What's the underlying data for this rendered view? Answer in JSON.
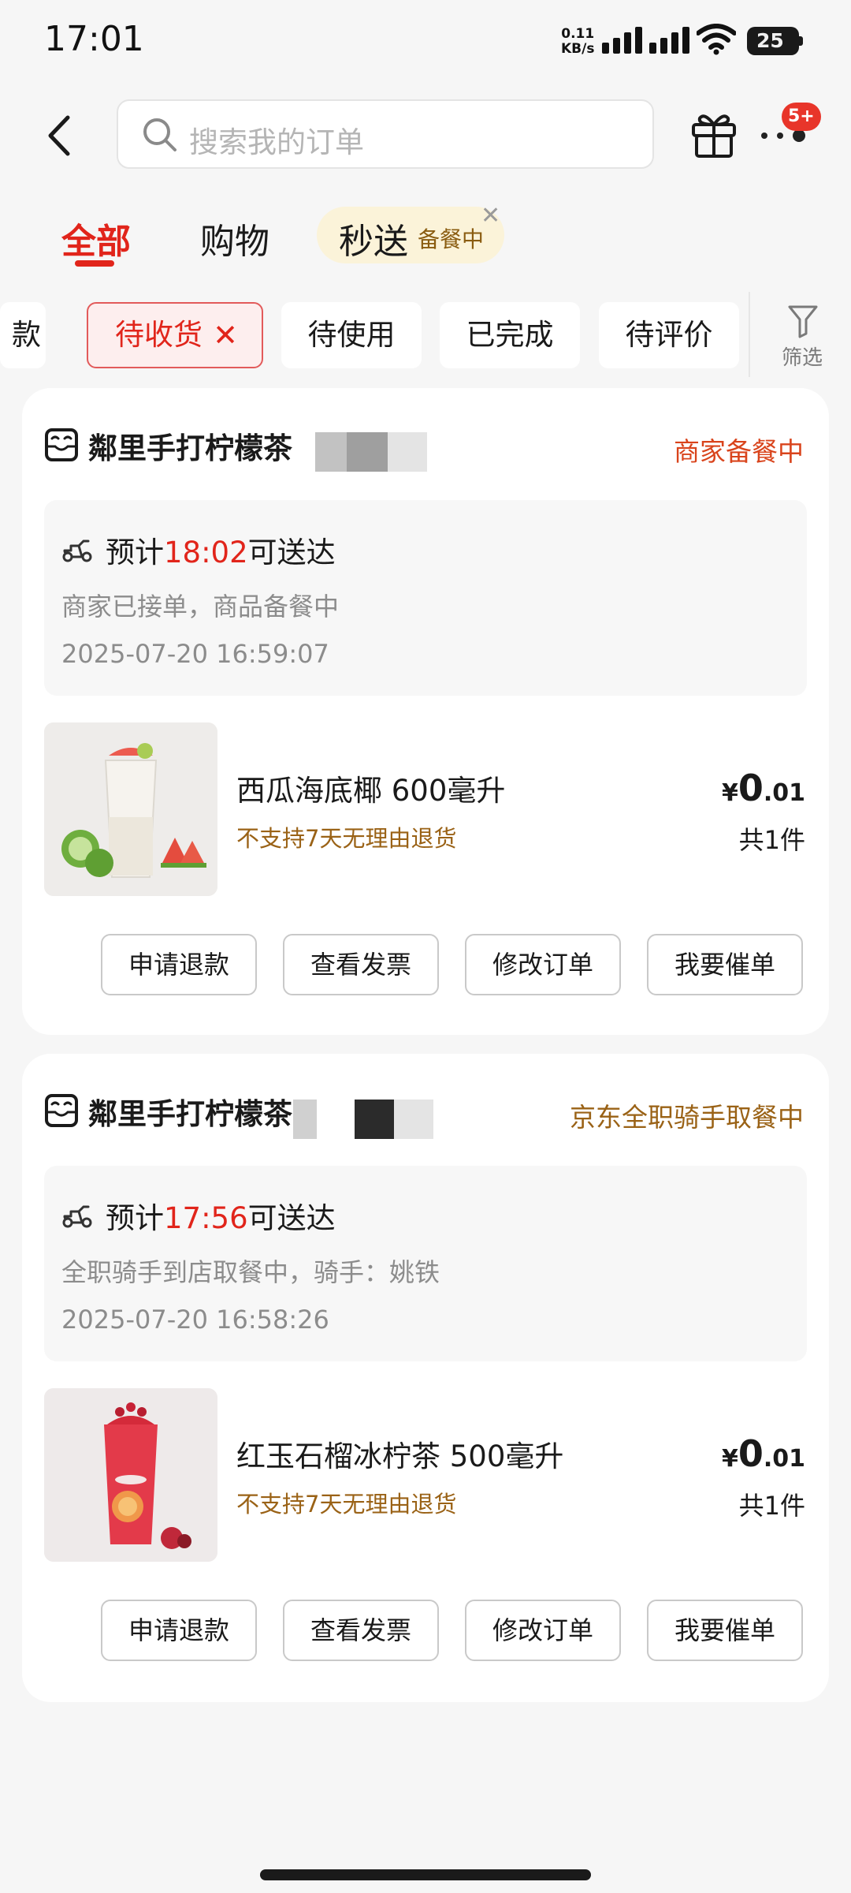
{
  "status_bar": {
    "time": "17:01",
    "net_speed_value": "0.11",
    "net_speed_unit": "KB/s",
    "battery_level": "25"
  },
  "header": {
    "search_placeholder": "搜索我的订单",
    "message_badge": "5+"
  },
  "main_tabs": {
    "all": "全部",
    "shopping": "购物",
    "flash_label": "秒送",
    "flash_status": "备餐中",
    "flash_close": "✕"
  },
  "filter_chips": {
    "partial": "款",
    "to_receive": "待收货",
    "to_receive_close": "✕",
    "to_use": "待使用",
    "completed": "已完成",
    "to_review": "待评价",
    "filter_label": "筛选"
  },
  "orders": [
    {
      "store_name": "鄰里手打柠檬茶",
      "status": "商家备餐中",
      "eta_prefix": "预计",
      "eta_time": "18:02",
      "eta_suffix": "可送达",
      "note": "商家已接单，商品备餐中",
      "order_time": "2025-07-20 16:59:07",
      "product_name": "西瓜海底椰 600毫升",
      "policy": "不支持7天无理由退货",
      "price_symbol": "¥",
      "price_int": "0",
      "price_dec": ".01",
      "quantity": "共1件",
      "buttons": [
        "申请退款",
        "查看发票",
        "修改订单",
        "我要催单"
      ]
    },
    {
      "store_name": "鄰里手打柠檬茶",
      "status": "京东全职骑手取餐中",
      "eta_prefix": "预计",
      "eta_time": "17:56",
      "eta_suffix": "可送达",
      "note": "全职骑手到店取餐中，骑手：姚铁",
      "order_time": "2025-07-20 16:58:26",
      "product_name": "红玉石榴冰柠茶 500毫升",
      "policy": "不支持7天无理由退货",
      "price_symbol": "¥",
      "price_int": "0",
      "price_dec": ".01",
      "quantity": "共1件",
      "buttons": [
        "申请退款",
        "查看发票",
        "修改订单",
        "我要催单"
      ]
    }
  ],
  "colors": {
    "accent_red": "#e1251b",
    "status_brown": "#9a6216",
    "flash_bg": "#fbf3d9"
  }
}
